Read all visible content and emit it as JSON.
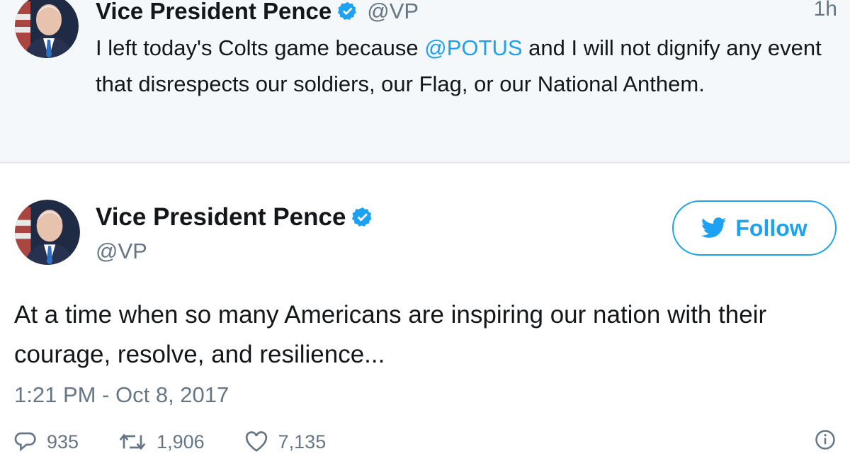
{
  "top_tweet": {
    "name": "Vice President Pence",
    "handle": "@VP",
    "time": "1h",
    "text_before": "I left today's Colts game because ",
    "mention": "@POTUS",
    "text_after": " and I will not dignify any event that disrespects our soldiers, our Flag, or our National Anthem."
  },
  "main_tweet": {
    "name": "Vice President Pence",
    "handle": "@VP",
    "follow_label": "Follow",
    "text": "At a time when so many Americans are inspiring our nation with their courage, resolve, and resilience...",
    "date": "1:21 PM - Oct 8, 2017",
    "replies": "935",
    "retweets": "1,906",
    "likes": "7,135"
  },
  "colors": {
    "accent": "#1da1f2",
    "muted": "#657786",
    "text": "#14171a",
    "card_bg": "#f5f8fa"
  },
  "icons": [
    "verified-badge-icon",
    "twitter-bird-icon",
    "reply-icon",
    "retweet-icon",
    "like-icon",
    "more-icon"
  ]
}
